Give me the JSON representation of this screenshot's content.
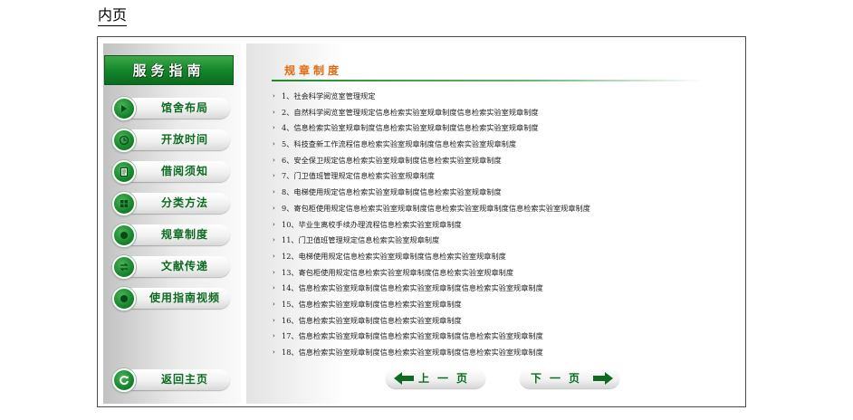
{
  "page_label": "内页",
  "sidebar": {
    "header": "服务指南",
    "items": [
      {
        "label": "馆舍布局",
        "icon": "arrow-right-icon"
      },
      {
        "label": "开放时间",
        "icon": "clock-icon"
      },
      {
        "label": "借阅须知",
        "icon": "document-icon"
      },
      {
        "label": "分类方法",
        "icon": "grid-icon"
      },
      {
        "label": "规章制度",
        "icon": "sphere-icon"
      },
      {
        "label": "文献传递",
        "icon": "transfer-icon"
      },
      {
        "label": "使用指南视频",
        "icon": "video-icon"
      }
    ],
    "home": {
      "label": "返回主页",
      "icon": "refresh-icon"
    }
  },
  "main": {
    "title": "规章制度",
    "bullet": "›",
    "rules": [
      "1、社会科学阅览室管理规定",
      "2、自然科学阅览室管理规定信息检索实验室规章制度信息检索实验室规章制度",
      "4、信息检索实验室规章制度信息检索实验室规章制度信息检索实验室规章制度",
      "5、科技查新工作流程信息检索实验室规章制度信息检索实验室规章制度",
      "6、安全保卫规定信息检索实验室规章制度信息检索实验室规章制度",
      "7、门卫值班管理规定信息检索实验室规章制度",
      "8、电梯使用规定信息检索实验室规章制度信息检索实验室规章制度",
      "9、寄包柜使用规定信息检索实验室规章制度信息检索实验室规章制度信息检索实验室规章制度",
      "10、毕业生离校手续办理流程信息检索实验室规章制度",
      "11、门卫值班管理规定信息检索实验室规章制度",
      "12、电梯使用规定信息检索实验室规章制度信息检索实验室规章制度",
      "13、寄包柜使用规定信息检索实验室规章制度信息检索实验室规章制度",
      "14、信息检索实验室规章制度信息检索实验室规章制度信息检索实验室规章制度",
      "15、信息检索实验室规章制度信息检索实验室规章制度",
      "16、信息检索实验室规章制度信息检索实验室规章制度",
      "17、信息检索实验室规章制度信息检索实验室规章制度信息检索实验室规章制度",
      "18、信息检索实验室规章制度信息检索实验室规章制度信息检索实验室规章制度"
    ],
    "prev_label": "上一页",
    "next_label": "下一页"
  },
  "colors": {
    "brand_green": "#15872b",
    "title_orange": "#e26a12",
    "nav_text": "#0c6b20"
  }
}
